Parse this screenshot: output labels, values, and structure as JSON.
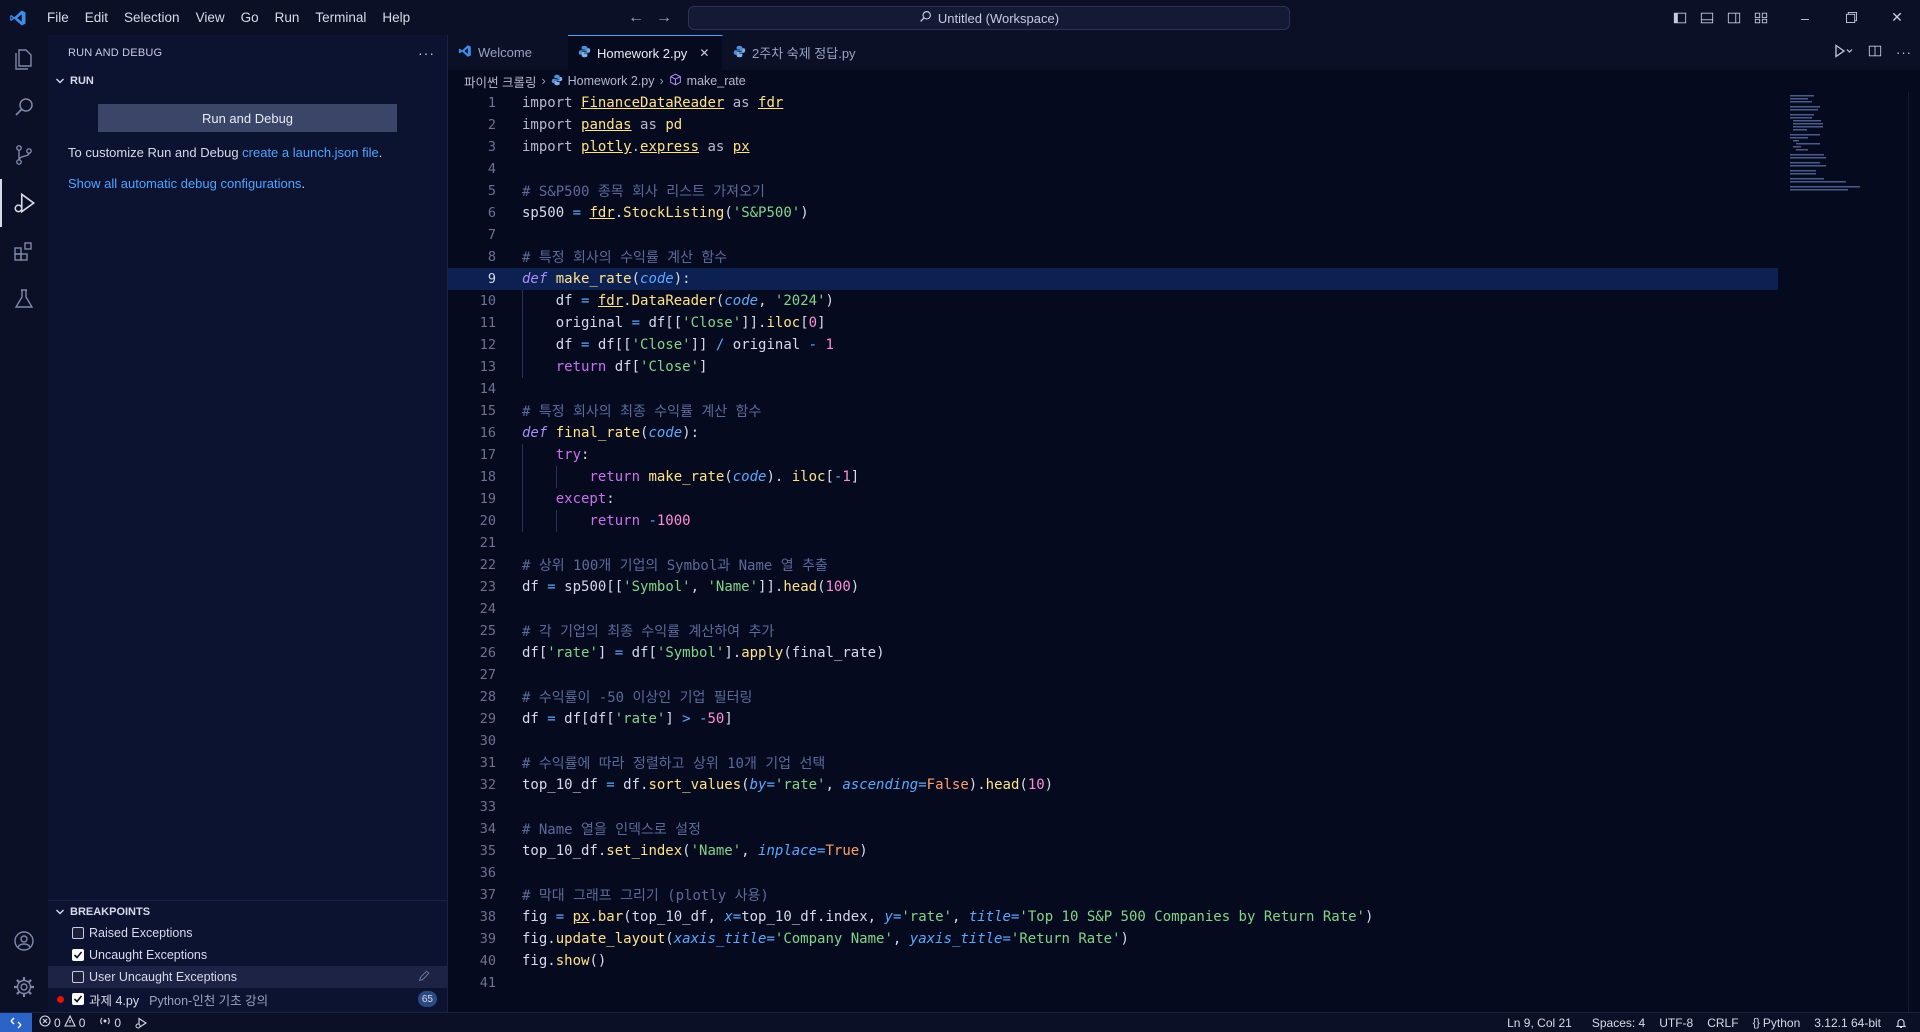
{
  "menu": [
    "File",
    "Edit",
    "Selection",
    "View",
    "Go",
    "Run",
    "Terminal",
    "Help"
  ],
  "command_center": "Untitled (Workspace)",
  "sidebar": {
    "title": "RUN AND DEBUG",
    "section": "RUN",
    "run_button": "Run and Debug",
    "customize_text": "To customize Run and Debug ",
    "customize_link": "create a launch.json file",
    "customize_suffix": ".",
    "show_all_link": "Show all automatic debug configurations",
    "show_all_suffix": ".",
    "breakpoints": {
      "title": "BREAKPOINTS",
      "items": [
        {
          "label": "Raised Exceptions",
          "checked": false
        },
        {
          "label": "Uncaught Exceptions",
          "checked": true
        },
        {
          "label": "User Uncaught Exceptions",
          "checked": false
        },
        {
          "label": "과제 4.py",
          "desc": "Python-인천 기초 강의",
          "checked": true,
          "badge": "65"
        }
      ]
    }
  },
  "tabs": [
    {
      "label": "Welcome",
      "active": false
    },
    {
      "label": "Homework 2.py",
      "active": true
    },
    {
      "label": "2주차 숙제 정답.py",
      "active": false
    }
  ],
  "breadcrumb": [
    "파이썬 크롤링",
    "Homework 2.py",
    "make_rate"
  ],
  "cursor_line": 9,
  "code": [
    [
      [
        "kw",
        "import "
      ],
      [
        "mod",
        "FinanceDataReader"
      ],
      [
        "kw",
        " as "
      ],
      [
        "mod",
        "fdr"
      ]
    ],
    [
      [
        "kw",
        "import "
      ],
      [
        "mod",
        "pandas"
      ],
      [
        "kw",
        " as "
      ],
      [
        "fn",
        "pd"
      ]
    ],
    [
      [
        "kw",
        "import "
      ],
      [
        "mod",
        "plotly"
      ],
      [
        "kw",
        "."
      ],
      [
        "mod",
        "express"
      ],
      [
        "kw",
        " as "
      ],
      [
        "mod",
        "px"
      ]
    ],
    [],
    [
      [
        "cmt",
        "# S&P500 종목 회사 리스트 가져오기"
      ]
    ],
    [
      [
        "",
        "sp500 "
      ],
      [
        "op",
        "= "
      ],
      [
        "mod",
        "fdr"
      ],
      [
        "",
        "."
      ],
      [
        "fn",
        "StockListing"
      ],
      [
        "",
        "("
      ],
      [
        "str",
        "'S&P500'"
      ],
      [
        "",
        ")"
      ]
    ],
    [],
    [
      [
        "cmt",
        "# 특정 회사의 수익률 계산 함수"
      ]
    ],
    [
      [
        "def",
        "def "
      ],
      [
        "fn",
        "make_rate"
      ],
      [
        "",
        "("
      ],
      [
        "param",
        "code"
      ],
      [
        "",
        "):"
      ]
    ],
    [
      [
        "",
        "    df "
      ],
      [
        "op",
        "= "
      ],
      [
        "mod",
        "fdr"
      ],
      [
        "",
        "."
      ],
      [
        "fn",
        "DataReader"
      ],
      [
        "",
        "("
      ],
      [
        "param",
        "code"
      ],
      [
        "",
        ", "
      ],
      [
        "str",
        "'2024'"
      ],
      [
        "",
        ")"
      ]
    ],
    [
      [
        "",
        "    original "
      ],
      [
        "op",
        "= "
      ],
      [
        "",
        "df[["
      ],
      [
        "str",
        "'Close'"
      ],
      [
        "",
        "]]."
      ],
      [
        "fn",
        "iloc"
      ],
      [
        "",
        "["
      ],
      [
        "num",
        "0"
      ],
      [
        "",
        "]"
      ]
    ],
    [
      [
        "",
        "    df "
      ],
      [
        "op",
        "= "
      ],
      [
        "",
        "df[["
      ],
      [
        "str",
        "'Close'"
      ],
      [
        "",
        "]] "
      ],
      [
        "op",
        "/ "
      ],
      [
        "",
        "original "
      ],
      [
        "op",
        "- "
      ],
      [
        "num",
        "1"
      ]
    ],
    [
      [
        "kw2",
        "    return "
      ],
      [
        "",
        "df["
      ],
      [
        "str",
        "'Close'"
      ],
      [
        "",
        "]"
      ]
    ],
    [],
    [
      [
        "cmt",
        "# 특정 회사의 최종 수익률 계산 함수"
      ]
    ],
    [
      [
        "def",
        "def "
      ],
      [
        "fn",
        "final_rate"
      ],
      [
        "",
        "("
      ],
      [
        "param",
        "code"
      ],
      [
        "",
        "):"
      ]
    ],
    [
      [
        "kw2",
        "    try"
      ],
      [
        "",
        ":"
      ]
    ],
    [
      [
        "kw2",
        "        return "
      ],
      [
        "fn",
        "make_rate"
      ],
      [
        "",
        "("
      ],
      [
        "param",
        "code"
      ],
      [
        "",
        "). "
      ],
      [
        "fn",
        "iloc"
      ],
      [
        "",
        "["
      ],
      [
        "op",
        "-"
      ],
      [
        "num",
        "1"
      ],
      [
        "",
        "]"
      ]
    ],
    [
      [
        "kw2",
        "    except"
      ],
      [
        "",
        ":"
      ]
    ],
    [
      [
        "kw2",
        "        return "
      ],
      [
        "op",
        "-"
      ],
      [
        "num",
        "1000"
      ]
    ],
    [],
    [
      [
        "cmt",
        "# 상위 100개 기업의 Symbol과 Name 열 추출"
      ]
    ],
    [
      [
        "",
        "df "
      ],
      [
        "op",
        "= "
      ],
      [
        "",
        "sp500[["
      ],
      [
        "str",
        "'Symbol'"
      ],
      [
        "",
        ", "
      ],
      [
        "str",
        "'Name'"
      ],
      [
        "",
        "]]."
      ],
      [
        "fn",
        "head"
      ],
      [
        "",
        "("
      ],
      [
        "num",
        "100"
      ],
      [
        "",
        ")"
      ]
    ],
    [],
    [
      [
        "cmt",
        "# 각 기업의 최종 수익률 계산하여 추가"
      ]
    ],
    [
      [
        "",
        "df["
      ],
      [
        "str",
        "'rate'"
      ],
      [
        "",
        "] "
      ],
      [
        "op",
        "= "
      ],
      [
        "",
        "df["
      ],
      [
        "str",
        "'Symbol'"
      ],
      [
        "",
        "]."
      ],
      [
        "fn",
        "apply"
      ],
      [
        "",
        "("
      ],
      [
        "",
        "final_rate"
      ],
      [
        "",
        ")"
      ]
    ],
    [],
    [
      [
        "cmt",
        "# 수익률이 -50 이상인 기업 필터링"
      ]
    ],
    [
      [
        "",
        "df "
      ],
      [
        "op",
        "= "
      ],
      [
        "",
        "df[df["
      ],
      [
        "str",
        "'rate'"
      ],
      [
        "",
        "] "
      ],
      [
        "op",
        "> -"
      ],
      [
        "num",
        "50"
      ],
      [
        "",
        "]"
      ]
    ],
    [],
    [
      [
        "cmt",
        "# 수익률에 따라 정렬하고 상위 10개 기업 선택"
      ]
    ],
    [
      [
        "",
        "top_10_df "
      ],
      [
        "op",
        "= "
      ],
      [
        "",
        "df."
      ],
      [
        "fn",
        "sort_values"
      ],
      [
        "",
        "("
      ],
      [
        "param",
        "by"
      ],
      [
        "op",
        "="
      ],
      [
        "str",
        "'rate'"
      ],
      [
        "",
        ", "
      ],
      [
        "param",
        "ascending"
      ],
      [
        "op",
        "="
      ],
      [
        "bool",
        "False"
      ],
      [
        "",
        ")."
      ],
      [
        "fn",
        "head"
      ],
      [
        "",
        "("
      ],
      [
        "num",
        "10"
      ],
      [
        "",
        ")"
      ]
    ],
    [],
    [
      [
        "cmt",
        "# Name 열을 인덱스로 설정"
      ]
    ],
    [
      [
        "",
        "top_10_df."
      ],
      [
        "fn",
        "set_index"
      ],
      [
        "",
        "("
      ],
      [
        "str",
        "'Name'"
      ],
      [
        "",
        ", "
      ],
      [
        "param",
        "inplace"
      ],
      [
        "op",
        "="
      ],
      [
        "bool",
        "True"
      ],
      [
        "",
        ")"
      ]
    ],
    [],
    [
      [
        "cmt",
        "# 막대 그래프 그리기 (plotly 사용)"
      ]
    ],
    [
      [
        "",
        "fig "
      ],
      [
        "op",
        "= "
      ],
      [
        "mod",
        "px"
      ],
      [
        "",
        "."
      ],
      [
        "fn",
        "bar"
      ],
      [
        "",
        "(top_10_df, "
      ],
      [
        "param",
        "x"
      ],
      [
        "op",
        "="
      ],
      [
        "",
        "top_10_df.index, "
      ],
      [
        "param",
        "y"
      ],
      [
        "op",
        "="
      ],
      [
        "str",
        "'rate'"
      ],
      [
        "",
        ", "
      ],
      [
        "param",
        "title"
      ],
      [
        "op",
        "="
      ],
      [
        "str",
        "'Top 10 S&P 500 Companies by Return Rate'"
      ],
      [
        "",
        ")"
      ]
    ],
    [
      [
        "",
        "fig."
      ],
      [
        "fn",
        "update_layout"
      ],
      [
        "",
        "("
      ],
      [
        "param",
        "xaxis_title"
      ],
      [
        "op",
        "="
      ],
      [
        "str",
        "'Company Name'"
      ],
      [
        "",
        ", "
      ],
      [
        "param",
        "yaxis_title"
      ],
      [
        "op",
        "="
      ],
      [
        "str",
        "'Return Rate'"
      ],
      [
        "",
        ")"
      ]
    ],
    [
      [
        "",
        "fig."
      ],
      [
        "fn",
        "show"
      ],
      [
        "",
        "()"
      ]
    ],
    []
  ],
  "statusbar": {
    "errors": "0",
    "warnings": "0",
    "ports": "0",
    "position": "Ln 9, Col 21",
    "spaces": "Spaces: 4",
    "encoding": "UTF-8",
    "eol": "CRLF",
    "language": "Python",
    "interpreter": "3.12.1 64-bit"
  },
  "colors": {
    "accent": "#4fa3ff",
    "remote": "#2b63c6",
    "breakpoint": "#e51400"
  }
}
